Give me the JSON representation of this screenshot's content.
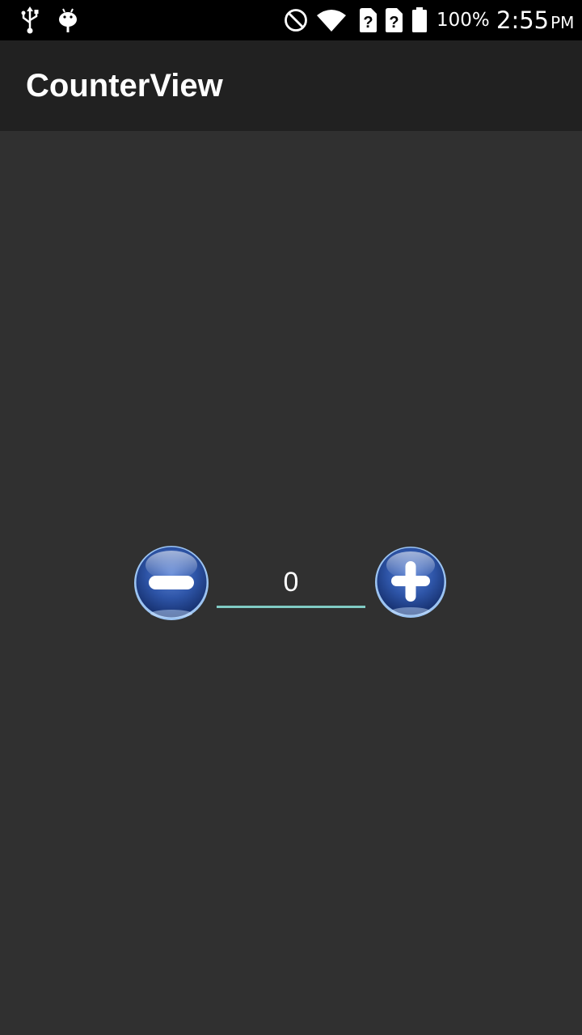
{
  "status_bar": {
    "left_icons": [
      "usb-icon",
      "android-debug-icon"
    ],
    "right_icons": [
      "do-not-disturb-icon",
      "wifi-icon",
      "sim-unknown-icon",
      "sim-unknown-icon",
      "battery-icon"
    ],
    "battery_percent": "100%",
    "time": "2:55",
    "ampm": "PM"
  },
  "app_bar": {
    "title": "CounterView"
  },
  "counter": {
    "value": "0",
    "decrement_icon": "minus-icon",
    "increment_icon": "plus-icon"
  },
  "colors": {
    "background": "#303030",
    "app_bar": "#212121",
    "status_bar": "#000000",
    "accent_underline": "#80cbc4",
    "button_blue": "#2a4f9e"
  }
}
